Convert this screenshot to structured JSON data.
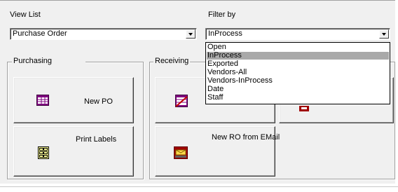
{
  "view_list": {
    "label": "View List",
    "selected": "Purchase Order"
  },
  "filter_by": {
    "label": "Filter by",
    "selected": "InProcess",
    "options": [
      "Open",
      "InProcess",
      "Exported",
      "Vendors-All",
      "Vendors-InProcess",
      "Date",
      "Staff"
    ],
    "highlighted": "InProcess"
  },
  "purchasing": {
    "title": "Purchasing",
    "buttons": [
      "New PO",
      "Print Labels"
    ]
  },
  "receiving": {
    "title": "Receiving",
    "buttons": [
      "New RO from EMail"
    ]
  },
  "icons": {
    "new_po": "purchase-order-form-icon",
    "print_labels": "label-sheet-icon",
    "receiving_top": "cancelled-form-icon",
    "receiving_email": "email-tray-icon"
  }
}
